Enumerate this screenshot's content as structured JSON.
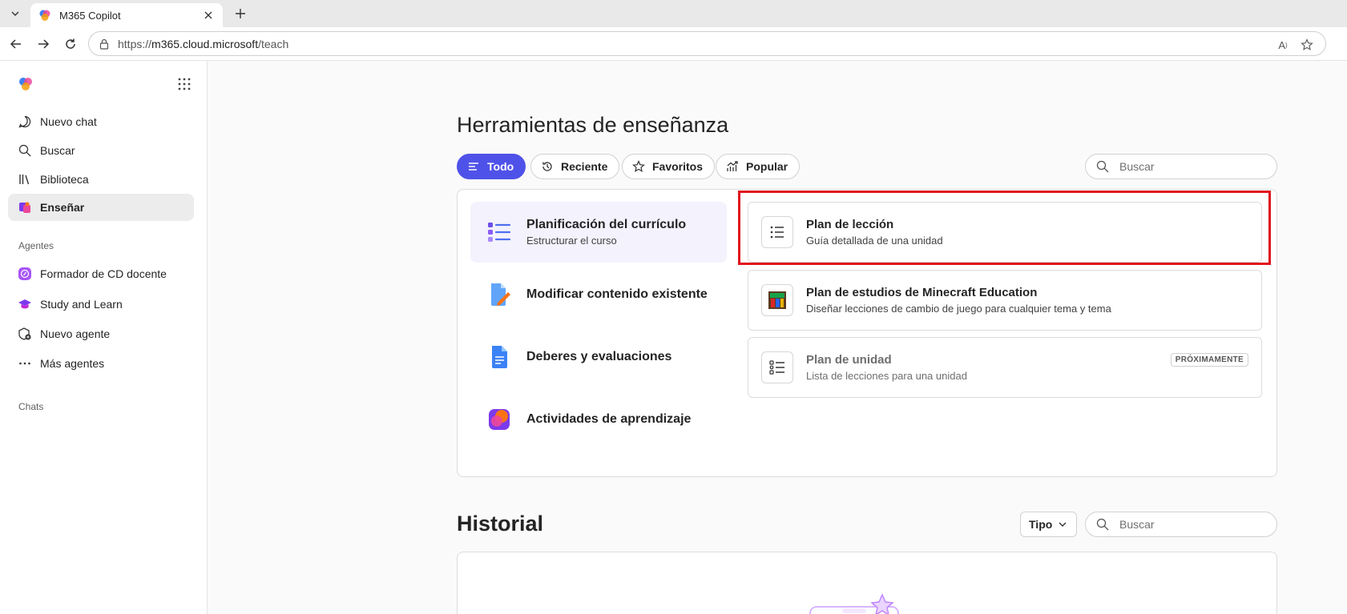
{
  "browser": {
    "tab_title": "M365 Copilot",
    "url_prefix": "https://",
    "url_domain": "m365.cloud.microsoft",
    "url_path": "/teach"
  },
  "sidebar": {
    "items": [
      {
        "label": "Nuevo chat",
        "icon": "chat-icon"
      },
      {
        "label": "Buscar",
        "icon": "search-icon"
      },
      {
        "label": "Biblioteca",
        "icon": "library-icon"
      },
      {
        "label": "Enseñar",
        "icon": "teach-icon",
        "active": true
      }
    ],
    "agents_heading": "Agentes",
    "agents": [
      {
        "label": "Formador de CD docente",
        "icon": "agent-formador-icon"
      },
      {
        "label": "Study and Learn",
        "icon": "graduation-cap-icon"
      },
      {
        "label": "Nuevo agente",
        "icon": "new-agent-icon"
      },
      {
        "label": "Más agentes",
        "icon": "more-icon"
      }
    ],
    "chats_heading": "Chats"
  },
  "main": {
    "title": "Herramientas de enseñanza",
    "filters": [
      {
        "label": "Todo",
        "active": true,
        "icon": "list-icon"
      },
      {
        "label": "Reciente",
        "icon": "history-icon"
      },
      {
        "label": "Favoritos",
        "icon": "star-icon"
      },
      {
        "label": "Popular",
        "icon": "trending-icon"
      }
    ],
    "search_placeholder": "Buscar",
    "categories": [
      {
        "title": "Planificación del currículo",
        "subtitle": "Estructurar el curso",
        "active": true
      },
      {
        "title": "Modificar contenido existente",
        "subtitle": ""
      },
      {
        "title": "Deberes y evaluaciones",
        "subtitle": ""
      },
      {
        "title": "Actividades de aprendizaje",
        "subtitle": ""
      }
    ],
    "options": [
      {
        "title": "Plan de lección",
        "subtitle": "Guía detallada de una unidad",
        "icon": "bulleted-list-icon"
      },
      {
        "title": "Plan de estudios de Minecraft Education",
        "subtitle": "Diseñar lecciones de cambio de juego para cualquier tema y tema",
        "icon": "minecraft-icon"
      },
      {
        "title": "Plan de unidad",
        "subtitle": "Lista de lecciones para una unidad",
        "icon": "checklist-icon",
        "badge": "PRÓXIMAMENTE"
      }
    ]
  },
  "history": {
    "title": "Historial",
    "type_label": "Tipo",
    "search_placeholder": "Buscar"
  },
  "colors": {
    "accent": "#4f52e8",
    "highlight": "#e1121e",
    "active_category_bg": "#f3f2fd"
  }
}
